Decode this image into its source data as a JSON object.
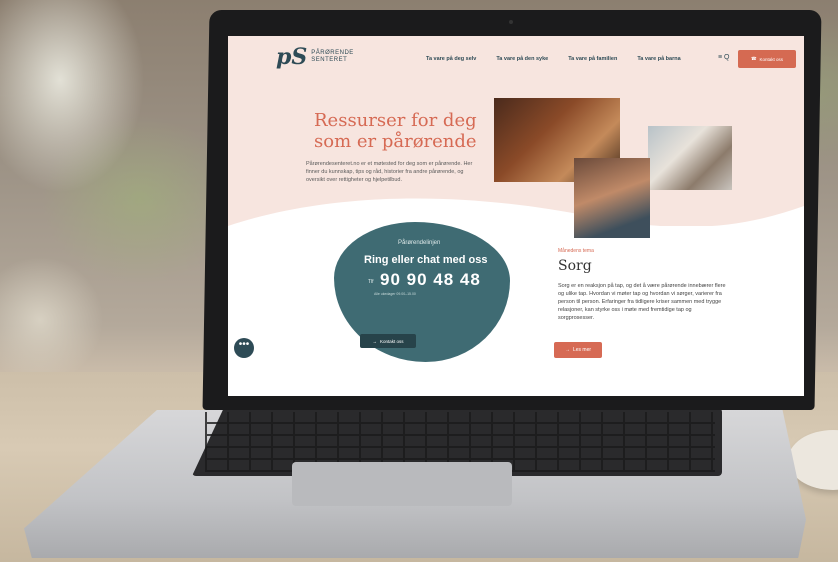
{
  "site": {
    "logo_mark": "pS",
    "logo_line1": "PÅRØRENDE",
    "logo_line2": "SENTERET",
    "nav": [
      "Ta vare på deg selv",
      "Ta vare på den syke",
      "Ta vare på familien",
      "Ta vare på barna"
    ],
    "menu_icons": "≡ Q",
    "cta_top": "Kontakt oss"
  },
  "hero": {
    "title": "Ressurser for deg som er pårørende",
    "text": "Pårørendesenteret.no er et møtested for deg som er pårørende. Her finner du kunnskap, tips og råd, historier fra andre pårørende, og oversikt over rettigheter og hjelpetilbud."
  },
  "contact": {
    "label": "Pårørendelinjen",
    "title": "Ring eller chat med oss",
    "phone_prefix": "Tlf",
    "phone": "90 90 48 48",
    "small": "Alle ukedager 09.00–15.00",
    "button": "Kontakt oss"
  },
  "theme": {
    "label": "Månedens tema",
    "title": "Sorg",
    "text": "Sorg er en reaksjon på tap, og det å være pårørende innebærer flere og ulike tap. Hvordan vi møter tap og hvordan vi sørger, varierer fra person til person. Erfaringer fra tidligere kriser sammen med trygge relasjoner, kan styrke oss i møte med fremtidige tap og sorgprosesser.",
    "button": "Les mer"
  },
  "chat_icon": "•••",
  "colors": {
    "accent": "#d66a54",
    "teal": "#3f6b73",
    "navy": "#2e4b56",
    "hero_bg": "#f7e5df"
  }
}
